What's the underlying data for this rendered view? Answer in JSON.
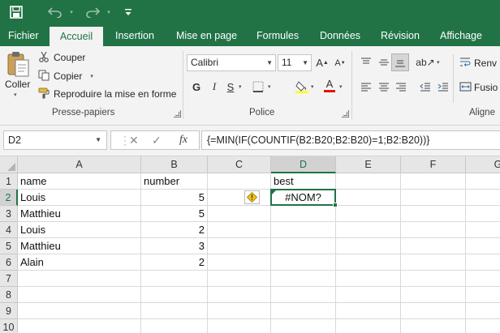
{
  "colors": {
    "accent": "#217346",
    "ribbon_bg": "#f3f3f3",
    "header_bg": "#e6e6e6",
    "warning": "#f2c318"
  },
  "quick_access": {
    "save_icon": "save-icon",
    "undo_icon": "undo-icon",
    "redo_icon": "redo-icon",
    "customize_icon": "customize-icon"
  },
  "tabs": [
    "Fichier",
    "Accueil",
    "Insertion",
    "Mise en page",
    "Formules",
    "Données",
    "Révision",
    "Affichage"
  ],
  "active_tab": "Accueil",
  "clipboard": {
    "paste_label": "Coller",
    "cut_label": "Couper",
    "copy_label": "Copier",
    "format_painter_label": "Reproduire la mise en forme",
    "group_label": "Presse-papiers"
  },
  "font": {
    "font_name": "Calibri",
    "font_size": "11",
    "bold": "G",
    "italic": "I",
    "underline": "S",
    "group_label": "Police"
  },
  "alignment": {
    "wrap_label": "Renv",
    "merge_label": "Fusio",
    "group_label": "Aligne"
  },
  "formula_bar": {
    "name_box": "D2",
    "formula": "{=MIN(IF(COUNTIF(B2:B20;B2:B20)=1;B2:B20))}"
  },
  "grid": {
    "columns": [
      "A",
      "B",
      "C",
      "D",
      "E",
      "F",
      "G"
    ],
    "selected_column": "D",
    "rows": [
      {
        "num": "1",
        "cells": [
          "name",
          "number",
          "",
          "best",
          "",
          "",
          ""
        ]
      },
      {
        "num": "2",
        "cells": [
          "Louis",
          "5",
          "",
          "#NOM?",
          "",
          "",
          ""
        ]
      },
      {
        "num": "3",
        "cells": [
          "Matthieu",
          "5",
          "",
          "",
          "",
          "",
          ""
        ]
      },
      {
        "num": "4",
        "cells": [
          "Louis",
          "2",
          "",
          "",
          "",
          "",
          ""
        ]
      },
      {
        "num": "5",
        "cells": [
          "Matthieu",
          "3",
          "",
          "",
          "",
          "",
          ""
        ]
      },
      {
        "num": "6",
        "cells": [
          "Alain",
          "2",
          "",
          "",
          "",
          "",
          ""
        ]
      },
      {
        "num": "7",
        "cells": [
          "",
          "",
          "",
          "",
          "",
          "",
          ""
        ]
      },
      {
        "num": "8",
        "cells": [
          "",
          "",
          "",
          "",
          "",
          "",
          ""
        ]
      },
      {
        "num": "9",
        "cells": [
          "",
          "",
          "",
          "",
          "",
          "",
          ""
        ]
      },
      {
        "num": "10",
        "cells": [
          "",
          "",
          "",
          "",
          "",
          "",
          ""
        ]
      }
    ],
    "selected_row": "2",
    "active_cell": "D2",
    "error_indicator_icon": "warning-icon"
  }
}
